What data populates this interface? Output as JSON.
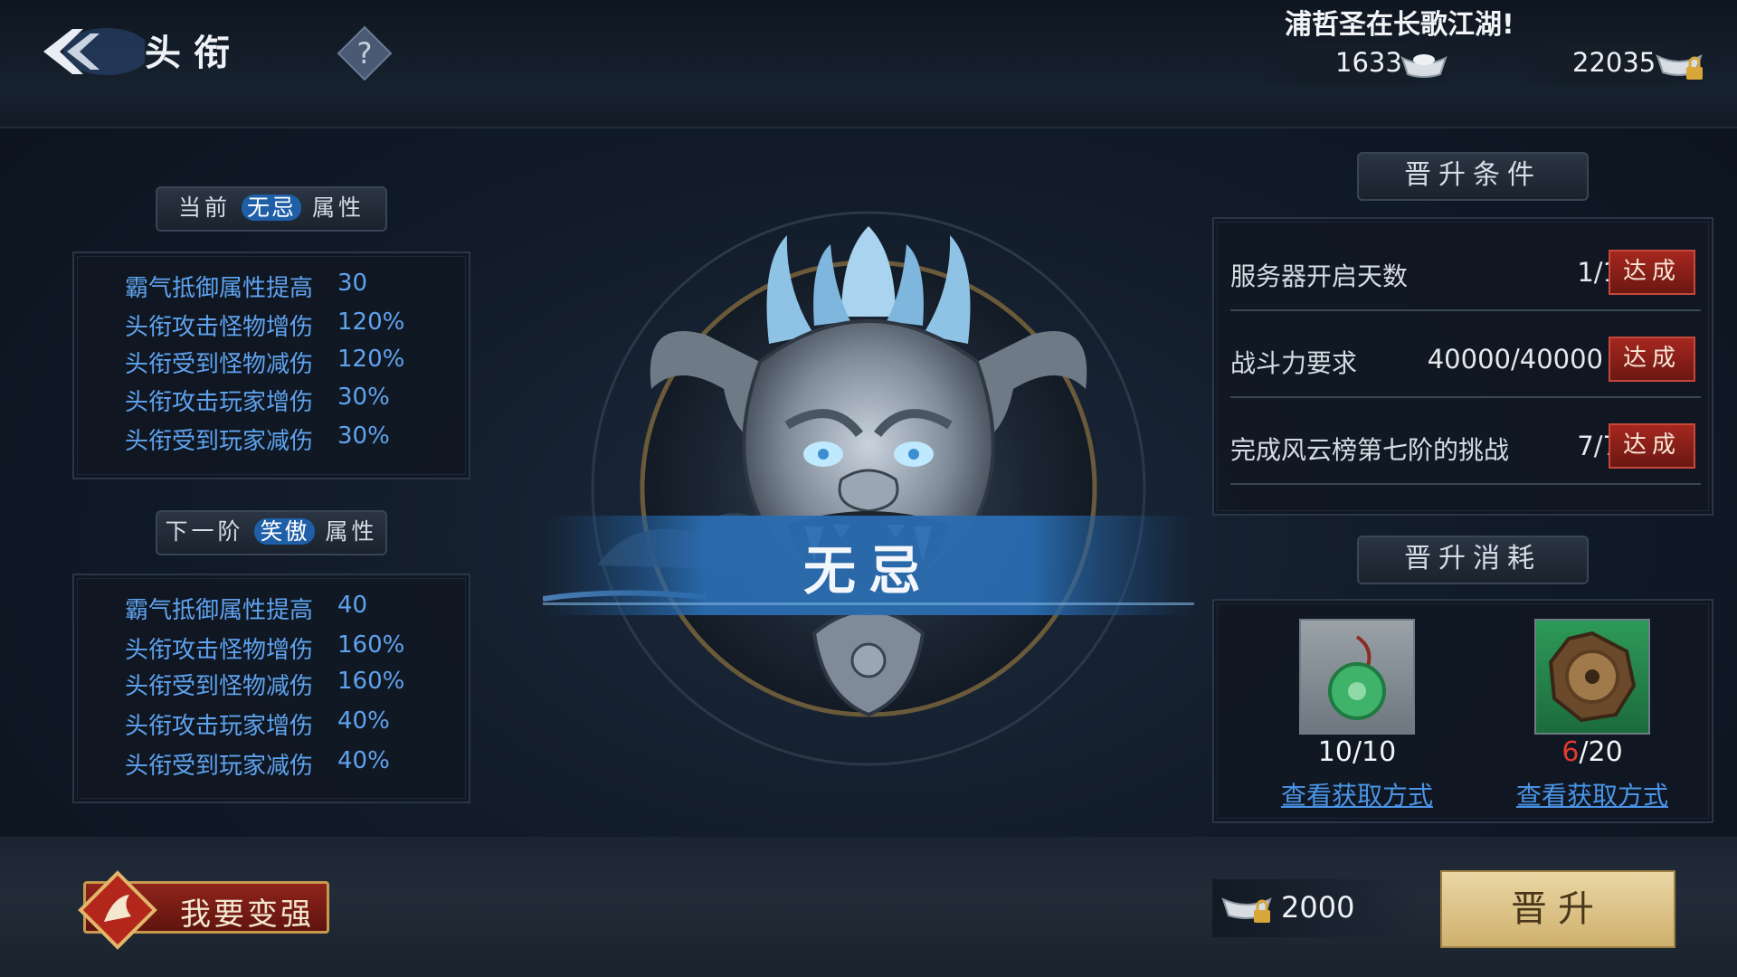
{
  "header": {
    "title": "头衔",
    "marquee": "浦哲圣在长歌江湖!",
    "currency_silver": "1633",
    "currency_gold": "22035"
  },
  "current": {
    "prefix": "当前",
    "rank": "无忌",
    "suffix": "属性",
    "attrs": [
      {
        "label": "霸气抵御属性提高",
        "value": "30"
      },
      {
        "label": "头衔攻击怪物增伤",
        "value": "120%"
      },
      {
        "label": "头衔受到怪物减伤",
        "value": "120%"
      },
      {
        "label": "头衔攻击玩家增伤",
        "value": "30%"
      },
      {
        "label": "头衔受到玩家减伤",
        "value": "30%"
      }
    ]
  },
  "next": {
    "prefix": "下一阶",
    "rank": "笑傲",
    "suffix": "属性",
    "attrs": [
      {
        "label": "霸气抵御属性提高",
        "value": "40"
      },
      {
        "label": "头衔攻击怪物增伤",
        "value": "160%"
      },
      {
        "label": "头衔受到怪物减伤",
        "value": "160%"
      },
      {
        "label": "头衔攻击玩家增伤",
        "value": "40%"
      },
      {
        "label": "头衔受到玩家减伤",
        "value": "40%"
      }
    ]
  },
  "emblem": {
    "name": "无忌"
  },
  "conditions": {
    "title": "晋升条件",
    "rows": [
      {
        "label": "服务器开启天数",
        "value": "1/1",
        "status": "达成"
      },
      {
        "label": "战斗力要求",
        "value": "40000/40000",
        "status": "达成"
      },
      {
        "label": "完成风云榜第七阶的挑战",
        "value": "7/7",
        "status": "达成"
      }
    ]
  },
  "consume": {
    "title": "晋升消耗",
    "items": [
      {
        "icon": "jade-pendant-icon",
        "have": "10",
        "need": "/10",
        "link": "查看获取方式"
      },
      {
        "icon": "bronze-medal-icon",
        "have": "6",
        "need": "/20",
        "link": "查看获取方式"
      }
    ]
  },
  "footer": {
    "strong_label": "我要变强",
    "cost": "2000",
    "upgrade_label": "晋升"
  },
  "colors": {
    "accent_blue": "#5fa3ef",
    "badge_red": "#a5271f",
    "upgrade_gold": "#e3cc93"
  }
}
